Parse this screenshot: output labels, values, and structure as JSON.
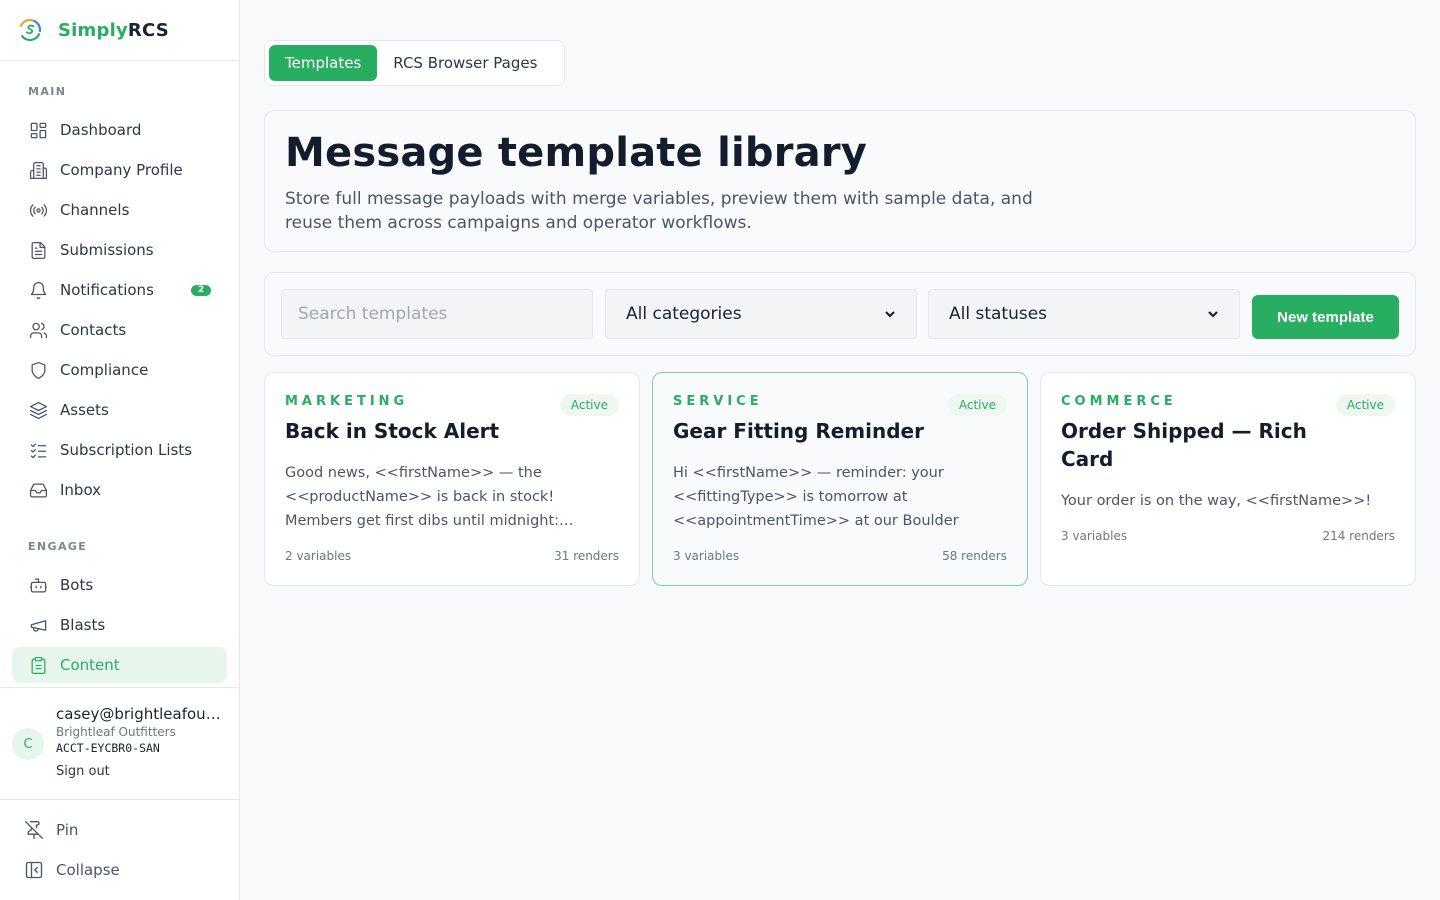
{
  "brand": {
    "name_green": "Simply",
    "name_dark": "RCS"
  },
  "sidebar": {
    "main_label": "MAIN",
    "engage_label": "ENGAGE",
    "main_items": [
      {
        "label": "Dashboard",
        "icon": "dashboard-icon"
      },
      {
        "label": "Company Profile",
        "icon": "building-icon"
      },
      {
        "label": "Channels",
        "icon": "broadcast-icon"
      },
      {
        "label": "Submissions",
        "icon": "document-icon"
      },
      {
        "label": "Notifications",
        "icon": "bell-icon",
        "badge": "2"
      },
      {
        "label": "Contacts",
        "icon": "users-icon"
      },
      {
        "label": "Compliance",
        "icon": "shield-icon"
      },
      {
        "label": "Assets",
        "icon": "layers-icon"
      },
      {
        "label": "Subscription Lists",
        "icon": "checklist-icon"
      },
      {
        "label": "Inbox",
        "icon": "inbox-icon"
      }
    ],
    "engage_items": [
      {
        "label": "Bots",
        "icon": "bot-icon"
      },
      {
        "label": "Blasts",
        "icon": "megaphone-icon"
      },
      {
        "label": "Content",
        "icon": "clipboard-icon",
        "active": true
      }
    ],
    "user": {
      "initial": "C",
      "email": "casey@brightleafoutfitters.com",
      "org": "Brightleaf Outfitters",
      "account": "ACCT-EYCBR0-SAN",
      "sign_out": "Sign out"
    },
    "pin_label": "Pin",
    "collapse_label": "Collapse"
  },
  "tabs": [
    {
      "label": "Templates",
      "active": true
    },
    {
      "label": "RCS Browser Pages",
      "active": false
    }
  ],
  "hero": {
    "title": "Message template library",
    "description": "Store full message payloads with merge variables, preview them with sample data, and reuse them across campaigns and operator workflows."
  },
  "filters": {
    "search_placeholder": "Search templates",
    "category_value": "All categories",
    "status_value": "All statuses",
    "new_button": "New template"
  },
  "cards": [
    {
      "category": "MARKETING",
      "status": "Active",
      "title": "Back in Stock Alert",
      "body": "Good news, <<firstName>> — the <<productName>> is back in stock! Members get first dibs until midnight:…",
      "variables": "2 variables",
      "renders": "31 renders"
    },
    {
      "category": "SERVICE",
      "status": "Active",
      "title": "Gear Fitting Reminder",
      "body": "Hi <<firstName>> — reminder: your <<fittingType>> is tomorrow at <<appointmentTime>> at our Boulder shop…",
      "variables": "3 variables",
      "renders": "58 renders"
    },
    {
      "category": "COMMERCE",
      "status": "Active",
      "title": "Order Shipped — Rich Card",
      "body": "Your order is on the way, <<firstName>>!",
      "variables": "3 variables",
      "renders": "214 renders"
    }
  ],
  "colors": {
    "accent": "#27ae60",
    "accent_light": "#e6f6ec"
  }
}
